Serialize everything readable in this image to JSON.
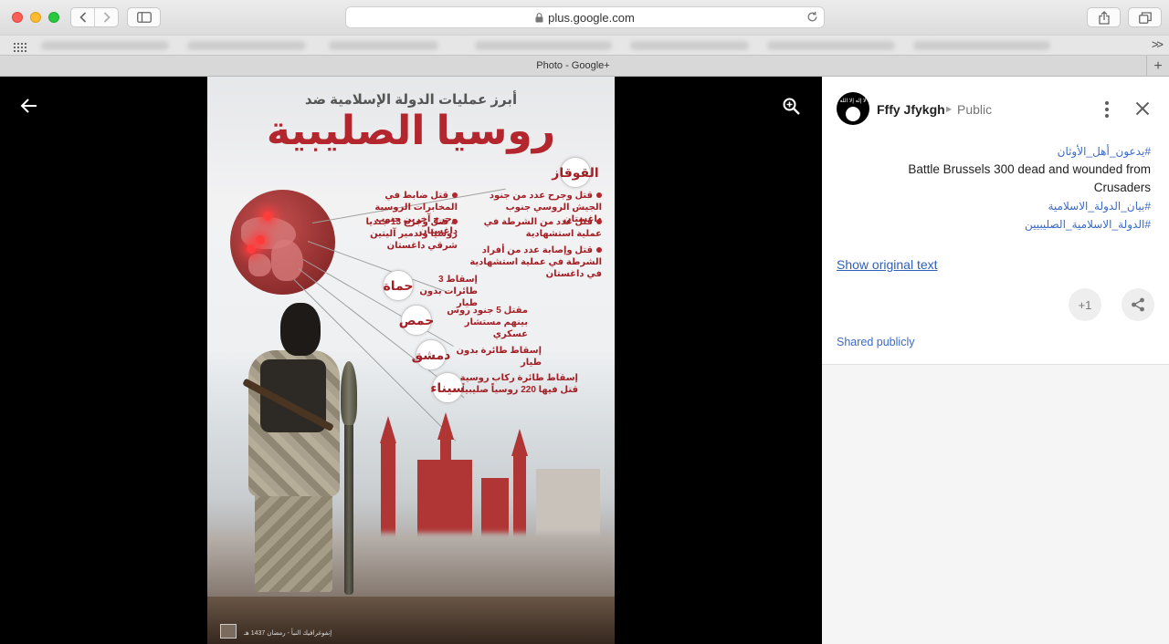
{
  "browser": {
    "url": "plus.google.com",
    "tab_title": "Photo - Google+",
    "new_tab_label": "+",
    "more_bookmarks_label": ">>"
  },
  "poster": {
    "subtitle": "أبرز عمليات الدولة الإسلامية ضد",
    "title": "روسيا الصليبية",
    "items": [
      "قتل وجرح عدد من جنود الجيش الروسي جنوب داغستان",
      "قتل ضابط في المخابرات الروسية وجرح آخرين جنوب داغستان",
      "قتل عدد من الشرطة في عملية استشهادية",
      "قتل وجرح 13 جنديا روسيا وتدمير آليتين شرقي داغستان",
      "قتل وإصابة عدد من أفراد الشرطة في عملية استشهادية في داغستان",
      "إسقاط 3 طائرات بدون طيار",
      "مقتل 5 جنود روس بينهم مستشار عسكري",
      "إسقاط طائرة بدون طيار",
      "إسقاط طائرة ركاب روسية قتل فيها 220 روسياً صليبياً"
    ],
    "badges": [
      "القوقاز",
      "حماة",
      "حمص",
      "دمشق",
      "سيناء"
    ],
    "footer": "إنفوغرافيك النبأ - رمضان 1437 هـ"
  },
  "post": {
    "avatar_text": "لا إله إلا الله",
    "author": "Fffy Jfykgh",
    "visibility": "Public",
    "hashtag_1": "#يدعون_أهل_الأوثان",
    "body": "Battle  Brussels 300 dead and wounded from Crusaders",
    "hashtag_2": "#بيان_الدولة_الاسلامية",
    "hashtag_3": "#الدولة_الاسلامية_الصليبيين",
    "show_original": "Show original text",
    "plus_one": "+1",
    "shared_publicly": "Shared publicly"
  },
  "icons": {
    "back": "arrow-left-icon",
    "zoom": "zoom-in-icon",
    "more": "more-vert-icon",
    "close": "close-icon",
    "share": "share-icon"
  },
  "colors": {
    "link": "#3b6ac7",
    "poster_red": "#b3262d"
  }
}
